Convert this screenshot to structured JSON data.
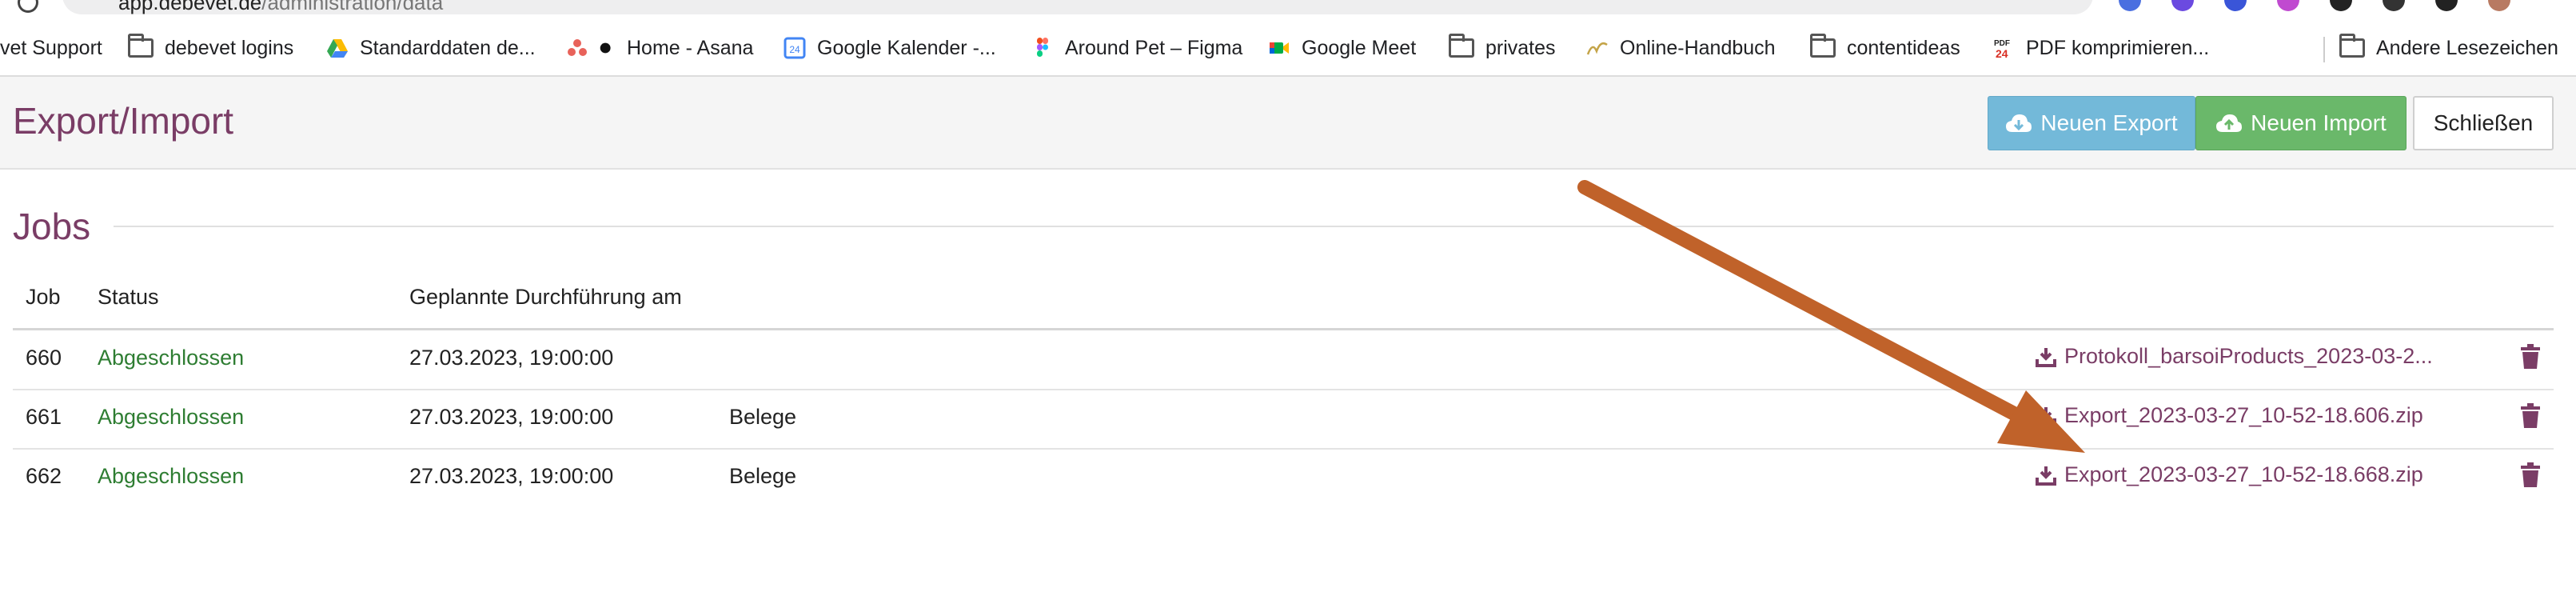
{
  "browser": {
    "url_host": "app.debevet.de",
    "url_path": "/administration/data"
  },
  "bookmarks": [
    {
      "label": "vet Support",
      "icon": "none"
    },
    {
      "label": "debevet logins",
      "icon": "folder-icon"
    },
    {
      "label": "Standarddaten de...",
      "icon": "google-drive-icon"
    },
    {
      "label": "Home - Asana",
      "icon": "asana-icon"
    },
    {
      "label": "Google Kalender -...",
      "icon": "google-calendar-icon"
    },
    {
      "label": "Around Pet – Figma",
      "icon": "figma-icon"
    },
    {
      "label": "Google Meet",
      "icon": "google-meet-icon"
    },
    {
      "label": "privates",
      "icon": "folder-icon"
    },
    {
      "label": "Online-Handbuch",
      "icon": "handbook-icon"
    },
    {
      "label": "contentideas",
      "icon": "folder-icon"
    },
    {
      "label": "PDF komprimieren...",
      "icon": "pdf24-icon"
    },
    {
      "label": "Andere Lesezeichen",
      "icon": "folder-icon"
    }
  ],
  "header": {
    "title": "Export/Import",
    "new_export_label": "Neuen Export",
    "new_import_label": "Neuen Import",
    "close_label": "Schließen"
  },
  "jobs": {
    "title": "Jobs",
    "columns": [
      "Job",
      "Status",
      "Geplannte Durchführung am"
    ],
    "rows": [
      {
        "job": "660",
        "status": "Abgeschlossen",
        "scheduled": "27.03.2023, 19:00:00",
        "type": "",
        "file": "Protokoll_barsoiProducts_2023-03-2..."
      },
      {
        "job": "661",
        "status": "Abgeschlossen",
        "scheduled": "27.03.2023, 19:00:00",
        "type": "Belege",
        "file": "Export_2023-03-27_10-52-18.606.zip"
      },
      {
        "job": "662",
        "status": "Abgeschlossen",
        "scheduled": "27.03.2023, 19:00:00",
        "type": "Belege",
        "file": "Export_2023-03-27_10-52-18.668.zip"
      }
    ]
  },
  "colors": {
    "accent": "#7a3d66",
    "export_button": "#73b9d9",
    "import_button": "#6ab86a",
    "status_done": "#2e7d32",
    "annotation_arrow": "#c0622a"
  }
}
